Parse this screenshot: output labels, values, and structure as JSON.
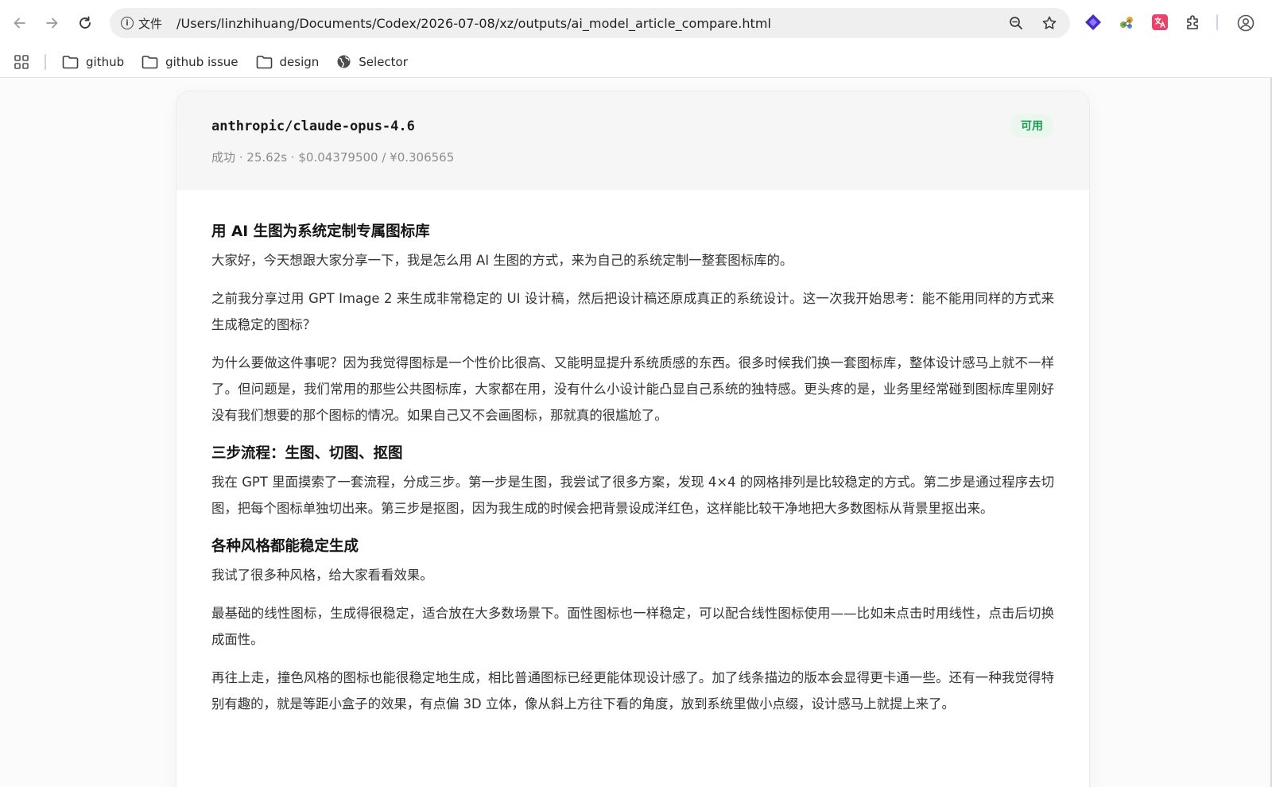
{
  "browser": {
    "site_label": "文件",
    "url": "/Users/linzhihuang/Documents/Codex/2026-07-08/xz/outputs/ai_model_article_compare.html"
  },
  "bookmarks": [
    {
      "label": "github",
      "icon": "folder-icon"
    },
    {
      "label": "github issue",
      "icon": "folder-icon"
    },
    {
      "label": "design",
      "icon": "folder-icon"
    },
    {
      "label": "Selector",
      "icon": "globe-icon"
    }
  ],
  "card": {
    "model": "anthropic/claude-opus-4.6",
    "meta": "成功 · 25.62s · $0.04379500 / ¥0.306565",
    "status": "可用",
    "status_color": "#1a9b55"
  },
  "article": {
    "h1": "用 AI 生图为系统定制专属图标库",
    "p1": "大家好，今天想跟大家分享一下，我是怎么用 AI 生图的方式，来为自己的系统定制一整套图标库的。",
    "p2": "之前我分享过用 GPT Image 2 来生成非常稳定的 UI 设计稿，然后把设计稿还原成真正的系统设计。这一次我开始思考：能不能用同样的方式来生成稳定的图标？",
    "p3": "为什么要做这件事呢？因为我觉得图标是一个性价比很高、又能明显提升系统质感的东西。很多时候我们换一套图标库，整体设计感马上就不一样了。但问题是，我们常用的那些公共图标库，大家都在用，没有什么小设计能凸显自己系统的独特感。更头疼的是，业务里经常碰到图标库里刚好没有我们想要的那个图标的情况。如果自己又不会画图标，那就真的很尴尬了。",
    "h2": "三步流程：生图、切图、抠图",
    "p4": "我在 GPT 里面摸索了一套流程，分成三步。第一步是生图，我尝试了很多方案，发现 4×4 的网格排列是比较稳定的方式。第二步是通过程序去切图，把每个图标单独切出来。第三步是抠图，因为我生成的时候会把背景设成洋红色，这样能比较干净地把大多数图标从背景里抠出来。",
    "h3": "各种风格都能稳定生成",
    "p5": "我试了很多种风格，给大家看看效果。",
    "p6": "最基础的线性图标，生成得很稳定，适合放在大多数场景下。面性图标也一样稳定，可以配合线性图标使用——比如未点击时用线性，点击后切换成面性。",
    "p7": "再往上走，撞色风格的图标也能很稳定地生成，相比普通图标已经更能体现设计感了。加了线条描边的版本会显得更卡通一些。还有一种我觉得特别有趣的，就是等距小盒子的效果，有点偏 3D 立体，像从斜上方往下看的角度，放到系统里做小点缀，设计感马上就提上来了。"
  }
}
